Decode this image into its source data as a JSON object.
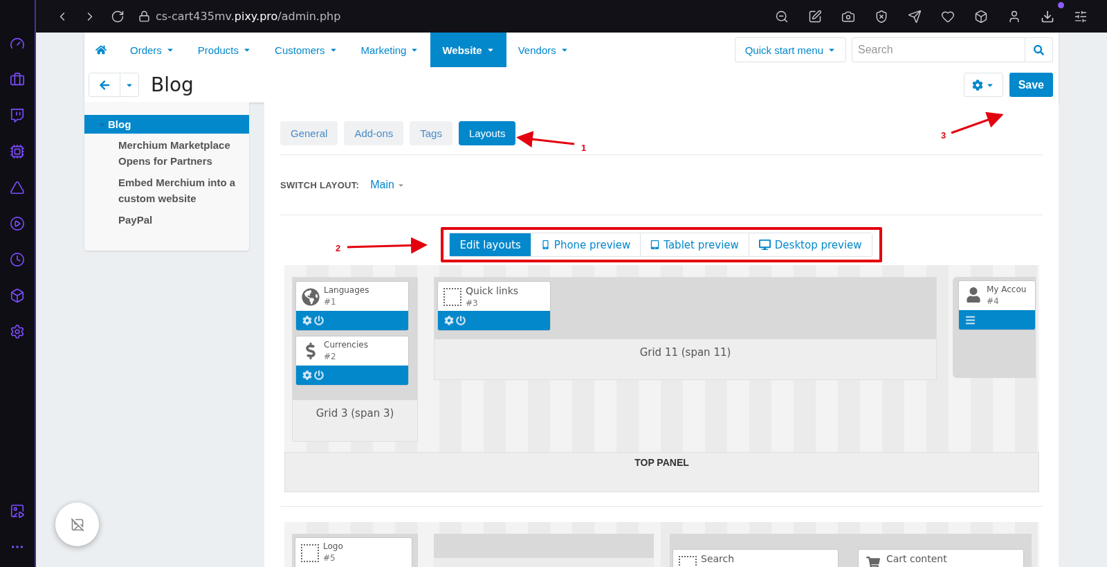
{
  "browser": {
    "url": "cs-cart435mv.**pixy.pro**/admin.php"
  },
  "nav": {
    "items": [
      {
        "label": "Orders",
        "selected": false
      },
      {
        "label": "Products",
        "selected": false
      },
      {
        "label": "Customers",
        "selected": false
      },
      {
        "label": "Marketing",
        "selected": false
      },
      {
        "label": "Website",
        "selected": true
      },
      {
        "label": "Vendors",
        "selected": false
      }
    ],
    "quick_start": "Quick start menu",
    "search": {
      "placeholder": "Search"
    }
  },
  "page": {
    "title": "Blog",
    "save": "Save"
  },
  "tree": [
    {
      "label": "Blog",
      "selected": true,
      "expanded": true,
      "children": [
        {
          "label": "Merchium Marketplace Opens for Partners",
          "selected": false
        },
        {
          "label": "Embed Merchium into a custom website",
          "selected": false
        },
        {
          "label": "PayPal",
          "selected": false
        }
      ]
    }
  ],
  "tabs": [
    {
      "label": "General",
      "selected": false
    },
    {
      "label": "Add-ons",
      "selected": false
    },
    {
      "label": "Tags",
      "selected": false
    },
    {
      "label": "Layouts",
      "selected": true
    }
  ],
  "switch_layout": {
    "label": "SWITCH LAYOUT:",
    "value": "Main"
  },
  "preview_modes": [
    {
      "label": "Edit layouts",
      "kind": "edit",
      "selected": true
    },
    {
      "label": "Phone preview",
      "kind": "phone",
      "selected": false
    },
    {
      "label": "Tablet preview",
      "kind": "tablet",
      "selected": false
    },
    {
      "label": "Desktop preview",
      "kind": "desktop",
      "selected": false
    }
  ],
  "top_panel": {
    "label": "TOP PANEL",
    "grids": [
      {
        "title": "Grid 3 (span 3)",
        "blocks": [
          {
            "name": "Languages",
            "id": "#1",
            "kind": "globe",
            "toolbar": {
              "kind": "controls"
            }
          },
          {
            "name": "Currencies",
            "id": "#2",
            "kind": "dollar",
            "toolbar": {
              "kind": "controls"
            }
          }
        ]
      },
      {
        "title": "Grid 11 (span 11)",
        "blocks": [
          {
            "name": "Quick links",
            "id": "#3",
            "kind": "empty",
            "toolbar": {
              "kind": "controls"
            }
          }
        ]
      },
      {
        "blocks": [
          {
            "name": "My Accou",
            "id": "#4",
            "kind": "user",
            "toolbar": {
              "kind": "menu"
            }
          }
        ]
      }
    ]
  },
  "second_panel": {
    "grids": [
      {
        "blocks": [
          {
            "name": "Logo",
            "id": "#5",
            "kind": "empty"
          }
        ]
      },
      {
        "kind": "empty_grid"
      },
      {
        "blocks": [
          {
            "name": "Search",
            "kind": "empty"
          },
          {
            "name": "Cart content",
            "kind": "cart"
          }
        ]
      }
    ]
  },
  "annotations": [
    {
      "label": "1"
    },
    {
      "label": "2"
    },
    {
      "label": "3"
    }
  ]
}
